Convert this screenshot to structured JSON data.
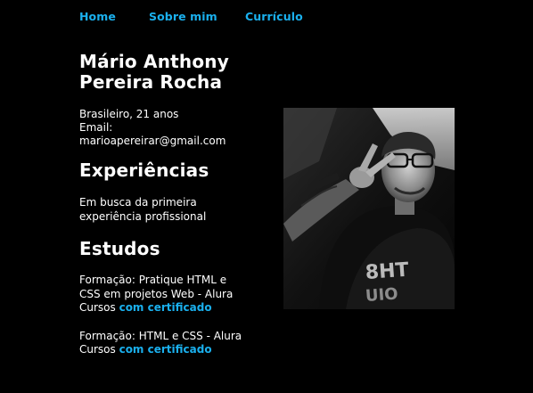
{
  "nav": {
    "home": "Home",
    "about": "Sobre mim",
    "resume": "Currículo"
  },
  "profile": {
    "name_line1": "Mário Anthony",
    "name_line2": "Pereira Rocha",
    "nationality_age": "Brasileiro, 21 anos",
    "email_label": "Email:",
    "email": "marioapereirar@gmail.com"
  },
  "experience": {
    "title": "Experiências",
    "text_line1": "Em busca da primeira",
    "text_line2": "experiência profissional"
  },
  "studies": {
    "title": "Estudos",
    "items": [
      {
        "line1": "Formação: Pratique HTML e",
        "line2": "CSS em projetos Web - Alura",
        "prefix": "Cursos ",
        "link": "com certificado"
      },
      {
        "line1": "Formação: HTML e CSS - Alura",
        "prefix": "Cursos ",
        "link": "com certificado"
      }
    ]
  },
  "photo": {
    "icon": "profile-photo"
  },
  "colors": {
    "background": "#000000",
    "accent": "#1ab0ee",
    "text": "#ffffff"
  }
}
